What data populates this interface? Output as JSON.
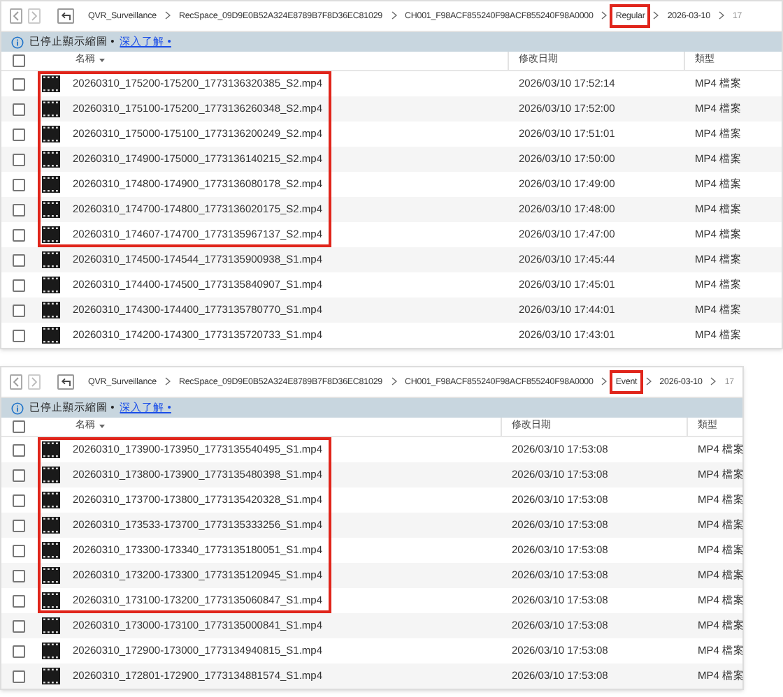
{
  "panels": [
    {
      "breadcrumb": [
        {
          "label": "QVR_Surveillance",
          "highlighted": false
        },
        {
          "label": "RecSpace_09D9E0B52A324E8789B7F8D36EC81029",
          "highlighted": false
        },
        {
          "label": "CH001_F98ACF855240F98ACF855240F98A0000",
          "highlighted": false
        },
        {
          "label": "Regular",
          "highlighted": true
        },
        {
          "label": "2026-03-10",
          "highlighted": false
        },
        {
          "label": "17",
          "highlighted": false
        }
      ],
      "notice": {
        "text": "已停止顯示縮圖 •",
        "link": "深入了解 •"
      },
      "columns": [
        "名稱",
        "修改日期",
        "類型"
      ],
      "all_checked": false,
      "rows": [
        {
          "name": "20260310_175200-175200_1773136320385_S2.mp4",
          "modified": "2026/03/10 17:52:14",
          "type": "MP4 檔案",
          "checked": false,
          "highlighted": true
        },
        {
          "name": "20260310_175100-175200_1773136260348_S2.mp4",
          "modified": "2026/03/10 17:52:00",
          "type": "MP4 檔案",
          "checked": false,
          "highlighted": true
        },
        {
          "name": "20260310_175000-175100_1773136200249_S2.mp4",
          "modified": "2026/03/10 17:51:01",
          "type": "MP4 檔案",
          "checked": false,
          "highlighted": true
        },
        {
          "name": "20260310_174900-175000_1773136140215_S2.mp4",
          "modified": "2026/03/10 17:50:00",
          "type": "MP4 檔案",
          "checked": false,
          "highlighted": true
        },
        {
          "name": "20260310_174800-174900_1773136080178_S2.mp4",
          "modified": "2026/03/10 17:49:00",
          "type": "MP4 檔案",
          "checked": false,
          "highlighted": true
        },
        {
          "name": "20260310_174700-174800_1773136020175_S2.mp4",
          "modified": "2026/03/10 17:48:00",
          "type": "MP4 檔案",
          "checked": false,
          "highlighted": true
        },
        {
          "name": "20260310_174607-174700_1773135967137_S2.mp4",
          "modified": "2026/03/10 17:47:00",
          "type": "MP4 檔案",
          "checked": false,
          "highlighted": true
        },
        {
          "name": "20260310_174500-174544_1773135900938_S1.mp4",
          "modified": "2026/03/10 17:45:44",
          "type": "MP4 檔案",
          "checked": false,
          "highlighted": false
        },
        {
          "name": "20260310_174400-174500_1773135840907_S1.mp4",
          "modified": "2026/03/10 17:45:01",
          "type": "MP4 檔案",
          "checked": false,
          "highlighted": false
        },
        {
          "name": "20260310_174300-174400_1773135780770_S1.mp4",
          "modified": "2026/03/10 17:44:01",
          "type": "MP4 檔案",
          "checked": false,
          "highlighted": false
        },
        {
          "name": "20260310_174200-174300_1773135720733_S1.mp4",
          "modified": "2026/03/10 17:43:01",
          "type": "MP4 檔案",
          "checked": false,
          "highlighted": false
        }
      ]
    },
    {
      "breadcrumb": [
        {
          "label": "QVR_Surveillance",
          "highlighted": false
        },
        {
          "label": "RecSpace_09D9E0B52A324E8789B7F8D36EC81029",
          "highlighted": false
        },
        {
          "label": "CH001_F98ACF855240F98ACF855240F98A0000",
          "highlighted": false
        },
        {
          "label": "Event",
          "highlighted": true
        },
        {
          "label": "2026-03-10",
          "highlighted": false
        },
        {
          "label": "17",
          "highlighted": false
        }
      ],
      "notice": {
        "text": "已停止顯示縮圖 •",
        "link": "深入了解 •"
      },
      "columns": [
        "名稱",
        "修改日期",
        "類型"
      ],
      "all_checked": false,
      "rows": [
        {
          "name": "20260310_173900-173950_1773135540495_S1.mp4",
          "modified": "2026/03/10 17:53:08",
          "type": "MP4 檔案",
          "checked": false,
          "highlighted": true
        },
        {
          "name": "20260310_173800-173900_1773135480398_S1.mp4",
          "modified": "2026/03/10 17:53:08",
          "type": "MP4 檔案",
          "checked": false,
          "highlighted": true
        },
        {
          "name": "20260310_173700-173800_1773135420328_S1.mp4",
          "modified": "2026/03/10 17:53:08",
          "type": "MP4 檔案",
          "checked": false,
          "highlighted": true
        },
        {
          "name": "20260310_173533-173700_1773135333256_S1.mp4",
          "modified": "2026/03/10 17:53:08",
          "type": "MP4 檔案",
          "checked": false,
          "highlighted": true
        },
        {
          "name": "20260310_173300-173340_1773135180051_S1.mp4",
          "modified": "2026/03/10 17:53:08",
          "type": "MP4 檔案",
          "checked": false,
          "highlighted": true
        },
        {
          "name": "20260310_173200-173300_1773135120945_S1.mp4",
          "modified": "2026/03/10 17:53:08",
          "type": "MP4 檔案",
          "checked": false,
          "highlighted": true
        },
        {
          "name": "20260310_173100-173200_1773135060847_S1.mp4",
          "modified": "2026/03/10 17:53:08",
          "type": "MP4 檔案",
          "checked": false,
          "highlighted": true
        },
        {
          "name": "20260310_173000-173100_1773135000841_S1.mp4",
          "modified": "2026/03/10 17:53:08",
          "type": "MP4 檔案",
          "checked": false,
          "highlighted": false
        },
        {
          "name": "20260310_172900-173000_1773134940815_S1.mp4",
          "modified": "2026/03/10 17:53:08",
          "type": "MP4 檔案",
          "checked": false,
          "highlighted": false
        },
        {
          "name": "20260310_172801-172900_1773134881574_S1.mp4",
          "modified": "2026/03/10 17:53:08",
          "type": "MP4 檔案",
          "checked": false,
          "highlighted": false
        }
      ]
    }
  ]
}
